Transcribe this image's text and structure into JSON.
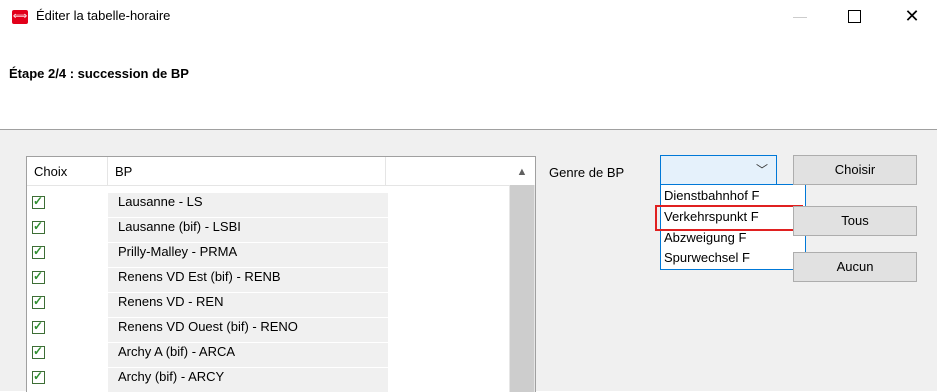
{
  "window": {
    "title": "Éditer la tabelle-horaire",
    "icon": "sbb-logo-icon",
    "controls": {
      "minimize": "—",
      "maximize": "□",
      "close": "✕"
    }
  },
  "wizard": {
    "step_title": "Étape 2/4 : succession de BP"
  },
  "table": {
    "columns": [
      "Choix",
      "BP"
    ],
    "rows": [
      {
        "checked": true,
        "bp": "Lausanne - LS"
      },
      {
        "checked": true,
        "bp": "Lausanne (bif) - LSBI"
      },
      {
        "checked": true,
        "bp": "Prilly-Malley - PRMA"
      },
      {
        "checked": true,
        "bp": "Renens VD Est (bif) - RENB"
      },
      {
        "checked": true,
        "bp": "Renens VD - REN"
      },
      {
        "checked": true,
        "bp": "Renens VD Ouest (bif) - RENO"
      },
      {
        "checked": true,
        "bp": "Archy A (bif) - ARCA"
      },
      {
        "checked": true,
        "bp": "Archy (bif) - ARCY"
      }
    ]
  },
  "filter": {
    "label": "Genre de BP",
    "selected": "",
    "options": [
      "Dienstbahnhof F",
      "Verkehrspunkt F",
      "Abzweigung F",
      "Spurwechsel F"
    ],
    "highlighted_option": "Verkehrspunkt F"
  },
  "buttons": {
    "choose": "Choisir",
    "all": "Tous",
    "none": "Aucun"
  },
  "colors": {
    "accent": "#0078d7",
    "highlight": "#e02020",
    "app_icon": "#e2001a"
  }
}
